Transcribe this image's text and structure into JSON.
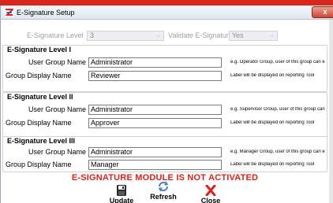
{
  "window": {
    "title": "E-Signature Setup",
    "close_label": "x"
  },
  "settings": {
    "level_label": "E-Signature Level",
    "level_value": "3",
    "validate_label": "Validate E-Signature",
    "validate_value": "Yes"
  },
  "sections": [
    {
      "title": "E-Signature Level I",
      "user_group_label": "User Group Name",
      "user_group_value": "Administrator",
      "user_group_hint": "e.g. Operator Group, user of this group can e",
      "display_label": "Group Display Name",
      "display_value": "Reviewer",
      "display_hint": "Label will be displayed on reporting Tool"
    },
    {
      "title": "E-Signature Level II",
      "user_group_label": "User Group Name",
      "user_group_value": "Administrator",
      "user_group_hint": "e.g. Supervisor Group, user of this group can",
      "display_label": "Group Display Name",
      "display_value": "Approver",
      "display_hint": "Label will be displayed on reporting Tool"
    },
    {
      "title": "E-Signature Level III",
      "user_group_label": "User Group Name",
      "user_group_value": "Administrator",
      "user_group_hint": "e.g. Manager Group, user of this group can e",
      "display_label": "Group Display Name",
      "display_value": "Manager",
      "display_hint": "Label will be displayed on reporting Tool"
    }
  ],
  "status_message": "E-SIGNATURE MODULE IS NOT ACTIVATED",
  "toolbar": {
    "update_label": "Update",
    "refresh_label": "Refresh",
    "close_label": "Close"
  },
  "icons": {
    "app": "app-logo-icon",
    "update": "floppy-disk-icon",
    "refresh": "refresh-icon",
    "close": "red-x-icon"
  },
  "colors": {
    "accent_red": "#e0201b",
    "window_close": "#c94a33",
    "title_bar": "#dfe7f2"
  }
}
